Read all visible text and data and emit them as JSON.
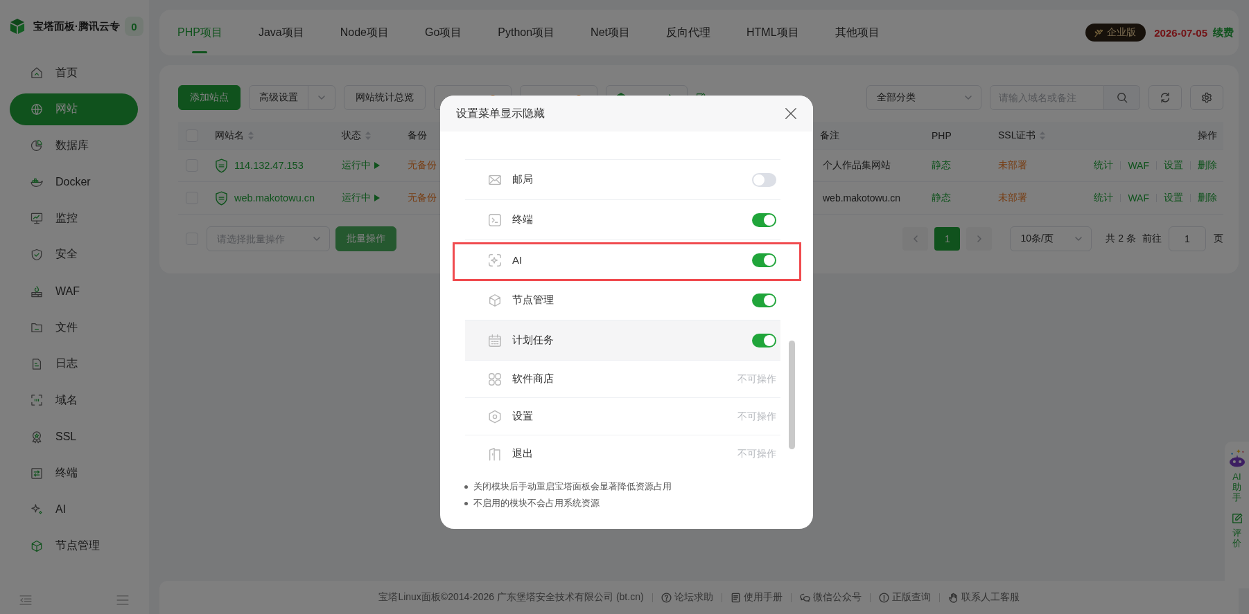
{
  "sidebar": {
    "brand": "宝塔面板·腾讯云专",
    "badge": "0",
    "items": [
      {
        "label": "首页",
        "selected": false
      },
      {
        "label": "网站",
        "selected": true
      },
      {
        "label": "数据库",
        "selected": false
      },
      {
        "label": "Docker",
        "selected": false
      },
      {
        "label": "监控",
        "selected": false
      },
      {
        "label": "安全",
        "selected": false
      },
      {
        "label": "WAF",
        "selected": false
      },
      {
        "label": "文件",
        "selected": false
      },
      {
        "label": "日志",
        "selected": false
      },
      {
        "label": "域名",
        "selected": false
      },
      {
        "label": "SSL",
        "selected": false
      },
      {
        "label": "终端",
        "selected": false
      },
      {
        "label": "AI",
        "selected": false
      },
      {
        "label": "节点管理",
        "selected": false
      }
    ]
  },
  "tabs": [
    {
      "label": "PHP项目",
      "selected": true
    },
    {
      "label": "Java项目",
      "selected": false
    },
    {
      "label": "Node项目",
      "selected": false
    },
    {
      "label": "Go项目",
      "selected": false
    },
    {
      "label": "Python项目",
      "selected": false
    },
    {
      "label": "Net项目",
      "selected": false
    },
    {
      "label": "反向代理",
      "selected": false
    },
    {
      "label": "HTML项目",
      "selected": false
    },
    {
      "label": "其他项目",
      "selected": false
    }
  ],
  "account": {
    "edition": "企业版",
    "expiry": "2026-07-05",
    "renew": "续费"
  },
  "toolbar": {
    "buttons": [
      {
        "label": "添加站点",
        "kind": "primary"
      },
      {
        "label": "高级设置",
        "kind": "split"
      },
      {
        "label": "网站统计总览",
        "kind": "plain"
      }
    ],
    "covered_buttons": [
      {
        "kind": "alert"
      },
      {
        "kind": "alert"
      },
      {
        "kind": "node"
      },
      {
        "kind": "link"
      }
    ],
    "category": "全部分类",
    "search": {
      "placeholder": "请输入域名或备注"
    }
  },
  "table": {
    "all_checked": false,
    "columns": [
      {
        "label": "网站名",
        "sortable": true
      },
      {
        "label": "状态",
        "sortable": true
      },
      {
        "label": "备份",
        "sortable": false
      },
      {
        "label": "备注",
        "sortable": false
      },
      {
        "label": "PHP",
        "sortable": false
      },
      {
        "label": "SSL证书",
        "sortable": true
      },
      {
        "label": "操作",
        "sortable": false
      }
    ],
    "rows": [
      {
        "checked": false,
        "name": "114.132.47.153",
        "status": "运行中",
        "backup": "无备份",
        "note": "个人作品集网站",
        "php": "静态",
        "ssl": "未部署",
        "actions": [
          "统计",
          "WAF",
          "设置",
          "删除"
        ]
      },
      {
        "checked": false,
        "name": "web.makotowu.cn",
        "status": "运行中",
        "backup": "无备份",
        "note": "web.makotowu.cn",
        "php": "静态",
        "ssl": "未部署",
        "actions": [
          "统计",
          "WAF",
          "设置",
          "删除"
        ]
      }
    ]
  },
  "pagination": {
    "checked": false,
    "batch_select": {
      "placeholder": "请选择批量操作"
    },
    "batch_button": {
      "label": "批量操作",
      "disabled": true
    },
    "pages": [
      {
        "label": "1",
        "selected": true
      }
    ],
    "page_size": "10条/页",
    "total": "共 2 条",
    "goto_label": "前往",
    "goto_value": "1",
    "page_unit": "页"
  },
  "modal": {
    "title": "设置菜单显示隐藏",
    "items": [
      {
        "label": "邮局",
        "kind": "toggle",
        "on": false,
        "highlighted": false,
        "hovered": false
      },
      {
        "label": "终端",
        "kind": "toggle",
        "on": true,
        "highlighted": false,
        "hovered": false
      },
      {
        "label": "AI",
        "kind": "toggle",
        "on": true,
        "highlighted": true,
        "hovered": false
      },
      {
        "label": "节点管理",
        "kind": "toggle",
        "on": true,
        "highlighted": false,
        "hovered": false
      },
      {
        "label": "计划任务",
        "kind": "toggle",
        "on": true,
        "highlighted": false,
        "hovered": true
      },
      {
        "label": "软件商店",
        "kind": "locked",
        "note": "不可操作",
        "highlighted": false,
        "hovered": false
      },
      {
        "label": "设置",
        "kind": "locked",
        "note": "不可操作",
        "highlighted": false,
        "hovered": false
      },
      {
        "label": "退出",
        "kind": "locked",
        "note": "不可操作",
        "highlighted": false,
        "hovered": false
      }
    ],
    "notes": [
      "关闭模块后手动重启宝塔面板会显著降低资源占用",
      "不启用的模块不会占用系统资源"
    ]
  },
  "footer": {
    "copyright": "宝塔Linux面板©2014-2026 广东堡塔安全技术有限公司 (bt.cn)",
    "links": [
      "论坛求助",
      "使用手册",
      "微信公众号",
      "正版查询",
      "联系人工客服"
    ]
  },
  "assistant": {
    "ai_label": "AI助手",
    "review_label": "评价"
  }
}
